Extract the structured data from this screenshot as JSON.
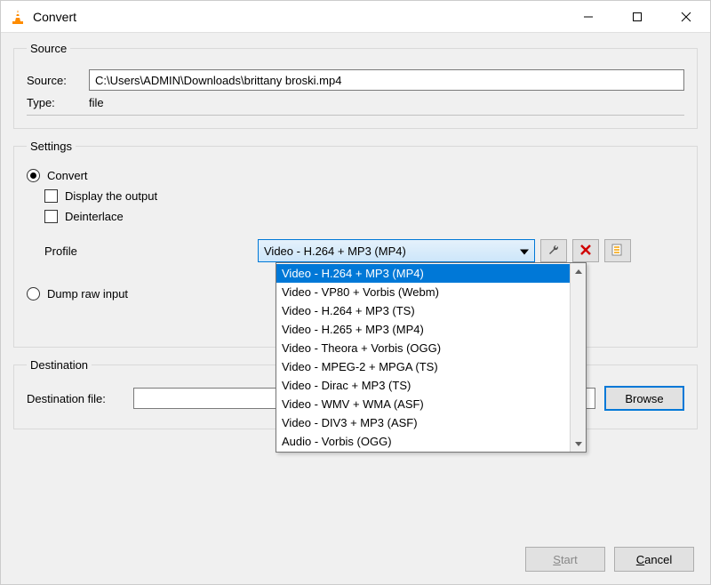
{
  "window": {
    "title": "Convert"
  },
  "source_group": {
    "legend": "Source",
    "source_label": "Source:",
    "source_value": "C:\\Users\\ADMIN\\Downloads\\brittany broski.mp4",
    "type_label": "Type:",
    "type_value": "file"
  },
  "settings_group": {
    "legend": "Settings",
    "convert_label": "Convert",
    "display_output_label": "Display the output",
    "deinterlace_label": "Deinterlace",
    "profile_label": "Profile",
    "profile_selected": "Video - H.264 + MP3 (MP4)",
    "profile_options": [
      "Video - H.264 + MP3 (MP4)",
      "Video - VP80 + Vorbis (Webm)",
      "Video - H.264 + MP3 (TS)",
      "Video - H.265 + MP3 (MP4)",
      "Video - Theora + Vorbis (OGG)",
      "Video - MPEG-2 + MPGA (TS)",
      "Video - Dirac + MP3 (TS)",
      "Video - WMV + WMA (ASF)",
      "Video - DIV3 + MP3 (ASF)",
      "Audio - Vorbis (OGG)"
    ],
    "dump_raw_label": "Dump raw input"
  },
  "destination_group": {
    "legend": "Destination",
    "dest_label": "Destination file:",
    "dest_value": "",
    "browse_label": "Browse"
  },
  "buttons": {
    "start": "Start",
    "cancel": "Cancel"
  },
  "icons": {
    "wrench": "wrench-icon",
    "delete": "delete-icon",
    "new_profile": "new-profile-icon"
  }
}
